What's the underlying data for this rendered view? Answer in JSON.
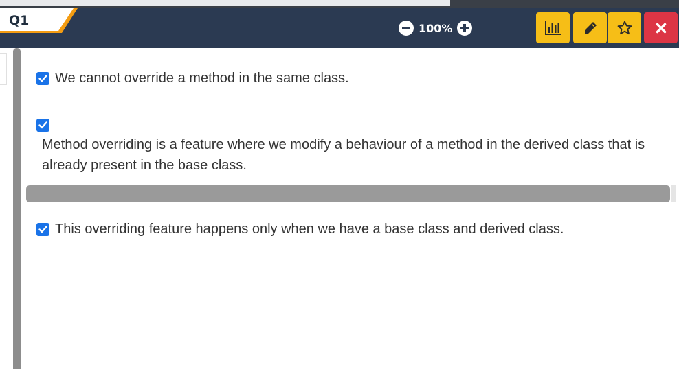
{
  "header": {
    "question_label": "Q1",
    "zoom_level": "100%"
  },
  "options": [
    {
      "checked": true,
      "text": "We cannot override a method in the same class."
    },
    {
      "checked": true,
      "text": "Method overriding is a feature where we modify a behaviour of a method in the derived class that is already present in the base class."
    },
    {
      "checked": true,
      "text": "This overriding feature happens only when we have a base class and derived class."
    }
  ],
  "toolbar": {
    "icons": [
      "bar-chart-icon",
      "pencil-icon",
      "star-icon",
      "close-icon"
    ]
  },
  "colors": {
    "header_bg": "#2b3a52",
    "accent_yellow": "#f6be17",
    "accent_orange": "#f39c12",
    "danger_red": "#dc3545",
    "checkbox_blue": "#1a73e8"
  }
}
